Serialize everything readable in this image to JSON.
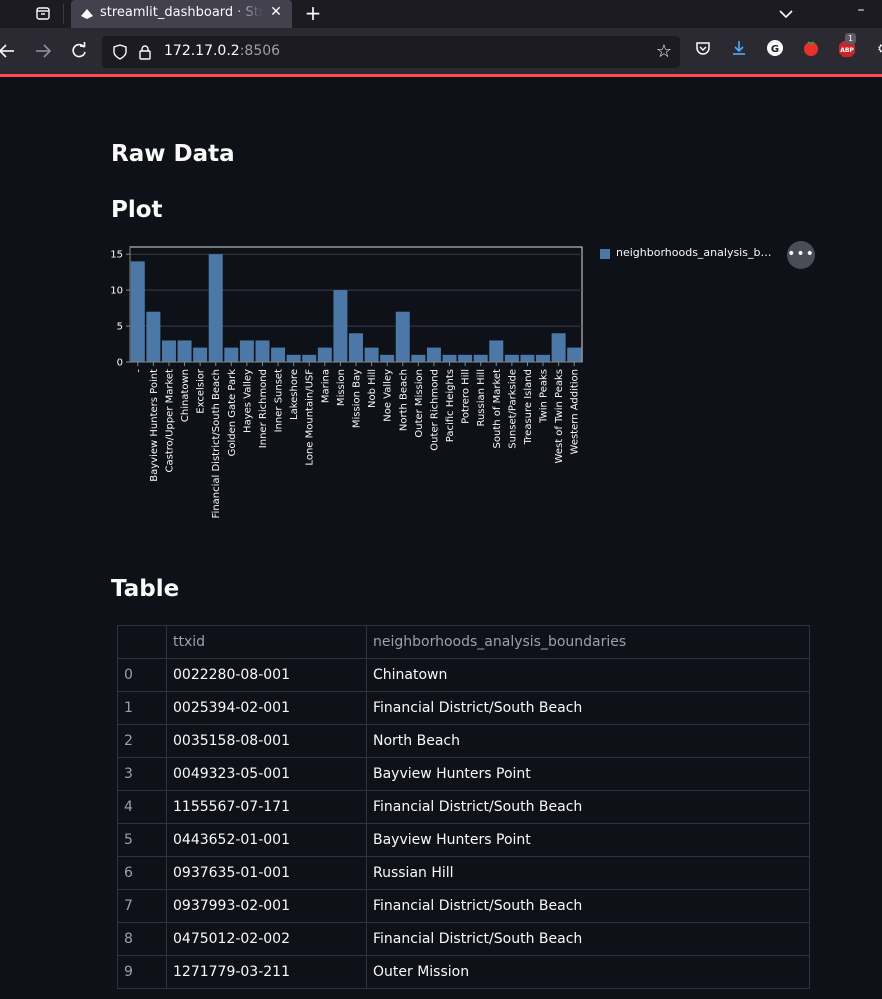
{
  "browser": {
    "tab_title": "streamlit_dashboard · Streamlit",
    "url_host": "172.17.0.2",
    "url_port": ":8506",
    "ext_badge": "1"
  },
  "page": {
    "heading_raw": "Raw Data",
    "heading_plot": "Plot",
    "heading_table": "Table"
  },
  "chart_data": {
    "type": "bar",
    "categories": [
      "-",
      "Bayview Hunters Point",
      "Castro/Upper Market",
      "Chinatown",
      "Excelsior",
      "Financial District/South Beach",
      "Golden Gate Park",
      "Hayes Valley",
      "Inner Richmond",
      "Inner Sunset",
      "Lakeshore",
      "Lone Mountain/USF",
      "Marina",
      "Mission",
      "Mission Bay",
      "Nob Hill",
      "Noe Valley",
      "North Beach",
      "Outer Mission",
      "Outer Richmond",
      "Pacific Heights",
      "Potrero Hill",
      "Russian Hill",
      "South of Market",
      "Sunset/Parkside",
      "Treasure Island",
      "Twin Peaks",
      "West of Twin Peaks",
      "Western Addition"
    ],
    "values": [
      14,
      7,
      3,
      3,
      2,
      15,
      2,
      3,
      3,
      2,
      1,
      1,
      2,
      10,
      4,
      2,
      1,
      7,
      1,
      2,
      1,
      1,
      1,
      3,
      1,
      1,
      1,
      4,
      2
    ],
    "yticks": [
      0,
      5,
      10,
      15
    ],
    "ylim": [
      0,
      16
    ],
    "legend": "neighborhoods_analysis_boundaries",
    "legend_position": "right",
    "color": "#4c78a8",
    "grid": true
  },
  "table": {
    "columns": [
      "",
      "ttxid",
      "neighborhoods_analysis_boundaries"
    ],
    "rows": [
      [
        "0",
        "0022280-08-001",
        "Chinatown"
      ],
      [
        "1",
        "0025394-02-001",
        "Financial District/South Beach"
      ],
      [
        "2",
        "0035158-08-001",
        "North Beach"
      ],
      [
        "3",
        "0049323-05-001",
        "Bayview Hunters Point"
      ],
      [
        "4",
        "1155567-07-171",
        "Financial District/South Beach"
      ],
      [
        "5",
        "0443652-01-001",
        "Bayview Hunters Point"
      ],
      [
        "6",
        "0937635-01-001",
        "Russian Hill"
      ],
      [
        "7",
        "0937993-02-001",
        "Financial District/South Beach"
      ],
      [
        "8",
        "0475012-02-002",
        "Financial District/South Beach"
      ],
      [
        "9",
        "1271779-03-211",
        "Outer Mission"
      ]
    ]
  },
  "colors": {
    "background": "#0e1117",
    "accent": "#ff4b4b",
    "bar": "#4c78a8"
  }
}
